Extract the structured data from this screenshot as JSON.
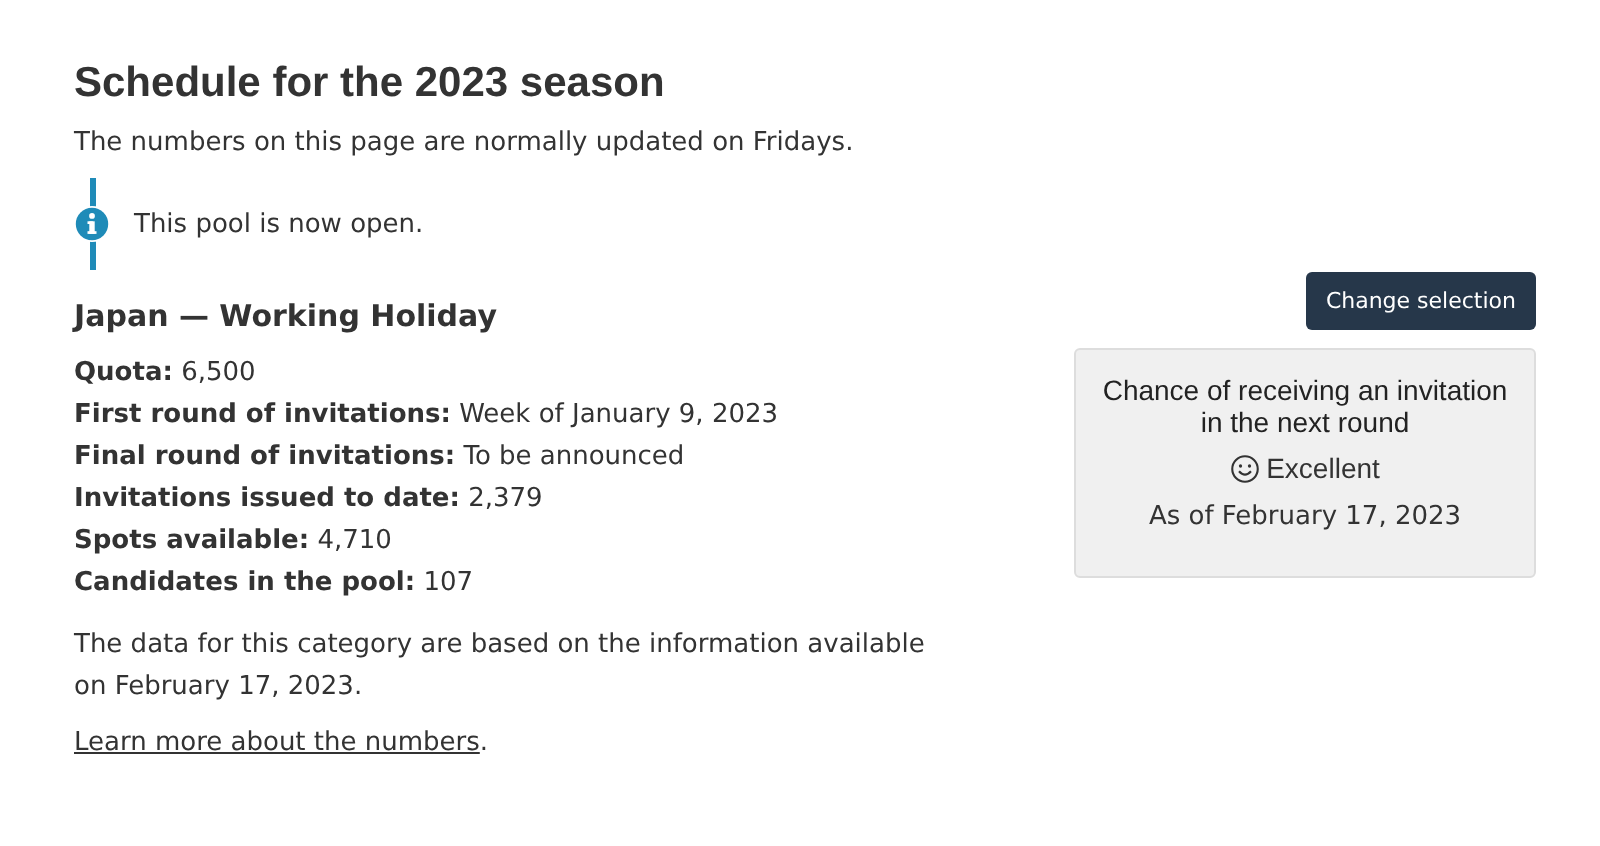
{
  "title": "Schedule for the 2023 season",
  "intro": "The numbers on this page are normally updated on Fridays.",
  "notice": "This pool is now open.",
  "category": "Japan — Working Holiday",
  "change_button": "Change selection",
  "facts": [
    "**Quota:** 6,500",
    "**First round of invitations:** Week of January 9, 2023",
    "**Final round of invitations:** To be announced",
    "**Invitations issued to date:** 2,379",
    "**Spots available:** 4,710",
    "**Candidates in the pool:** 107"
  ],
  "data_note": "The data for this category are based on the information available on February 17, 2023.",
  "link": "Learn more about the numbers",
  "link_after": ".",
  "chance": {
    "heading": "Chance of receiving an invitation in the next round",
    "rating": "Excellent",
    "as_of": "As of February 17, 2023"
  }
}
